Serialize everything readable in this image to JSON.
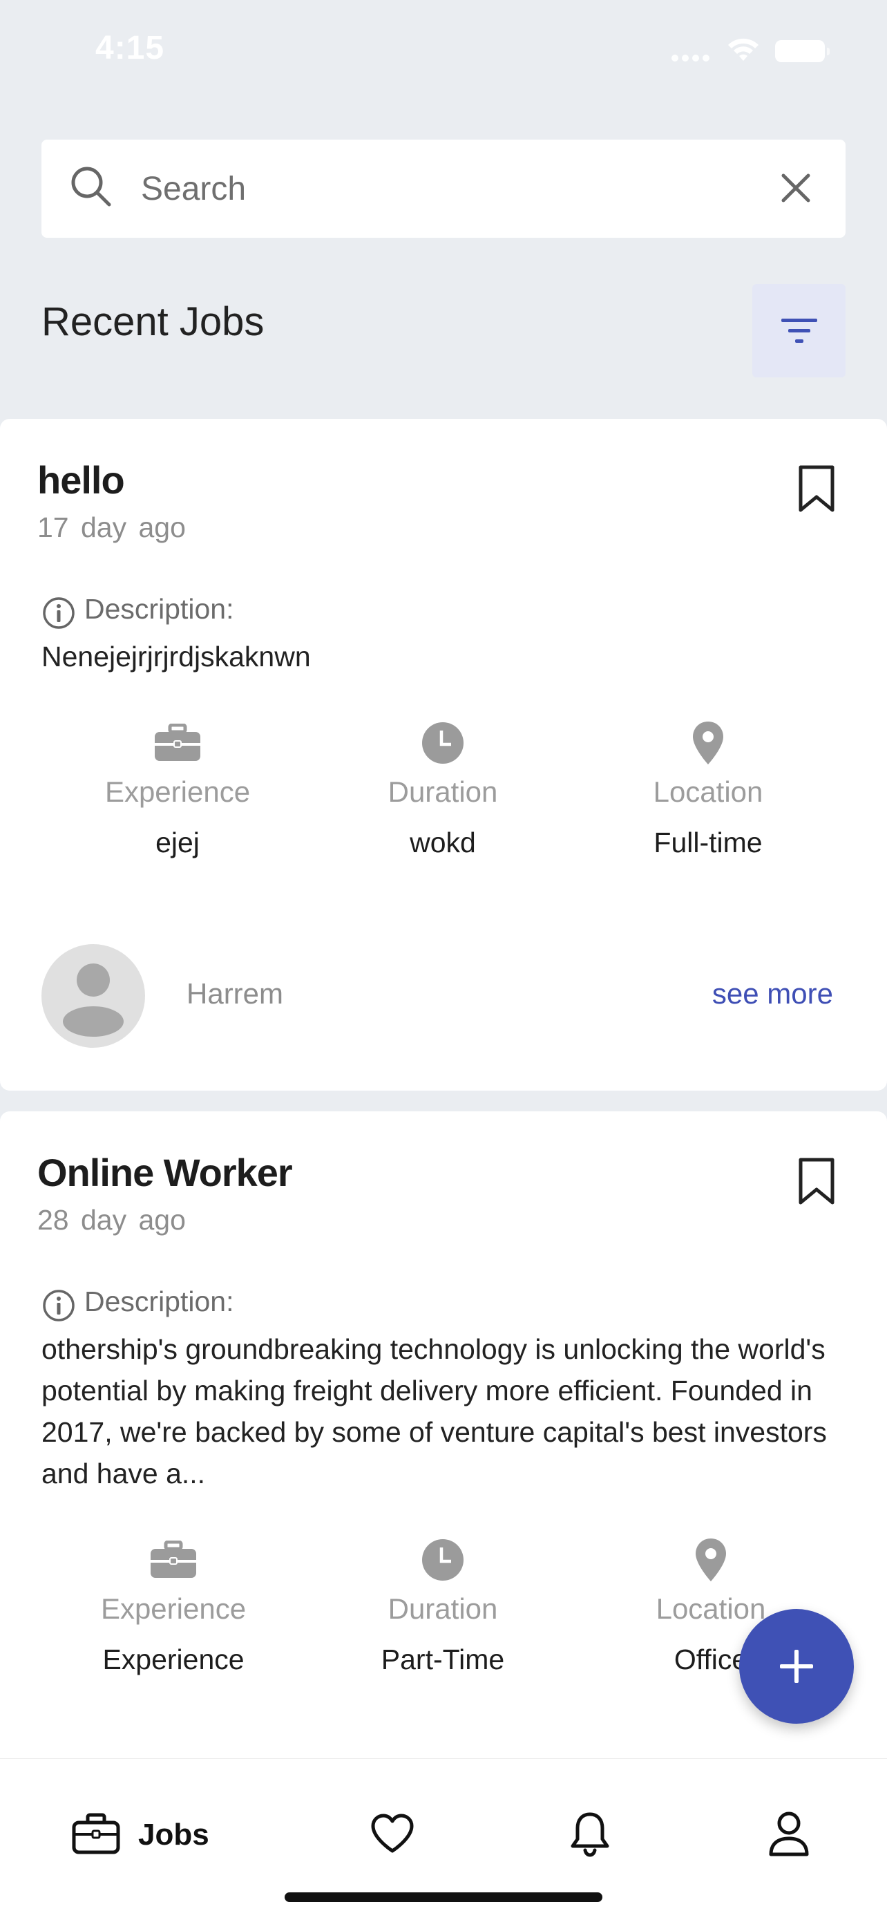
{
  "status_bar": {
    "time": "4:15"
  },
  "search": {
    "placeholder": "Search",
    "value": ""
  },
  "section": {
    "title": "Recent Jobs"
  },
  "jobs": [
    {
      "title": "hello",
      "age": "17 day  ago",
      "description_label": "Description:",
      "description": "Nenejejrjrjrdjskaknwn",
      "meta": [
        {
          "icon": "briefcase-icon",
          "label": "Experience",
          "value": "ejej"
        },
        {
          "icon": "clock-icon",
          "label": "Duration",
          "value": "wokd"
        },
        {
          "icon": "location-pin-icon",
          "label": "Location",
          "value": "Full-time"
        }
      ],
      "poster": "Harrem",
      "see_more": "see more"
    },
    {
      "title": "Online Worker",
      "age": "28 day  ago",
      "description_label": "Description:",
      "description": "othership's groundbreaking technology is unlocking the world's potential by making freight delivery more efficient. Founded in 2017, we're backed by some of venture capital's best investors and have a...",
      "meta": [
        {
          "icon": "briefcase-icon",
          "label": "Experience",
          "value": "Experience"
        },
        {
          "icon": "clock-icon",
          "label": "Duration",
          "value": "Part-Time"
        },
        {
          "icon": "location-pin-icon",
          "label": "Location",
          "value": "Office"
        }
      ]
    }
  ],
  "bottom_nav": {
    "items": [
      {
        "icon": "briefcase-icon",
        "label": "Jobs",
        "active": true
      },
      {
        "icon": "heart-icon",
        "label": ""
      },
      {
        "icon": "bell-icon",
        "label": ""
      },
      {
        "icon": "person-icon",
        "label": ""
      }
    ]
  },
  "colors": {
    "accent": "#3f51b5",
    "background": "#eaedf1",
    "filter_bg": "#e4e7f6",
    "muted_text": "#8d8d8d"
  }
}
